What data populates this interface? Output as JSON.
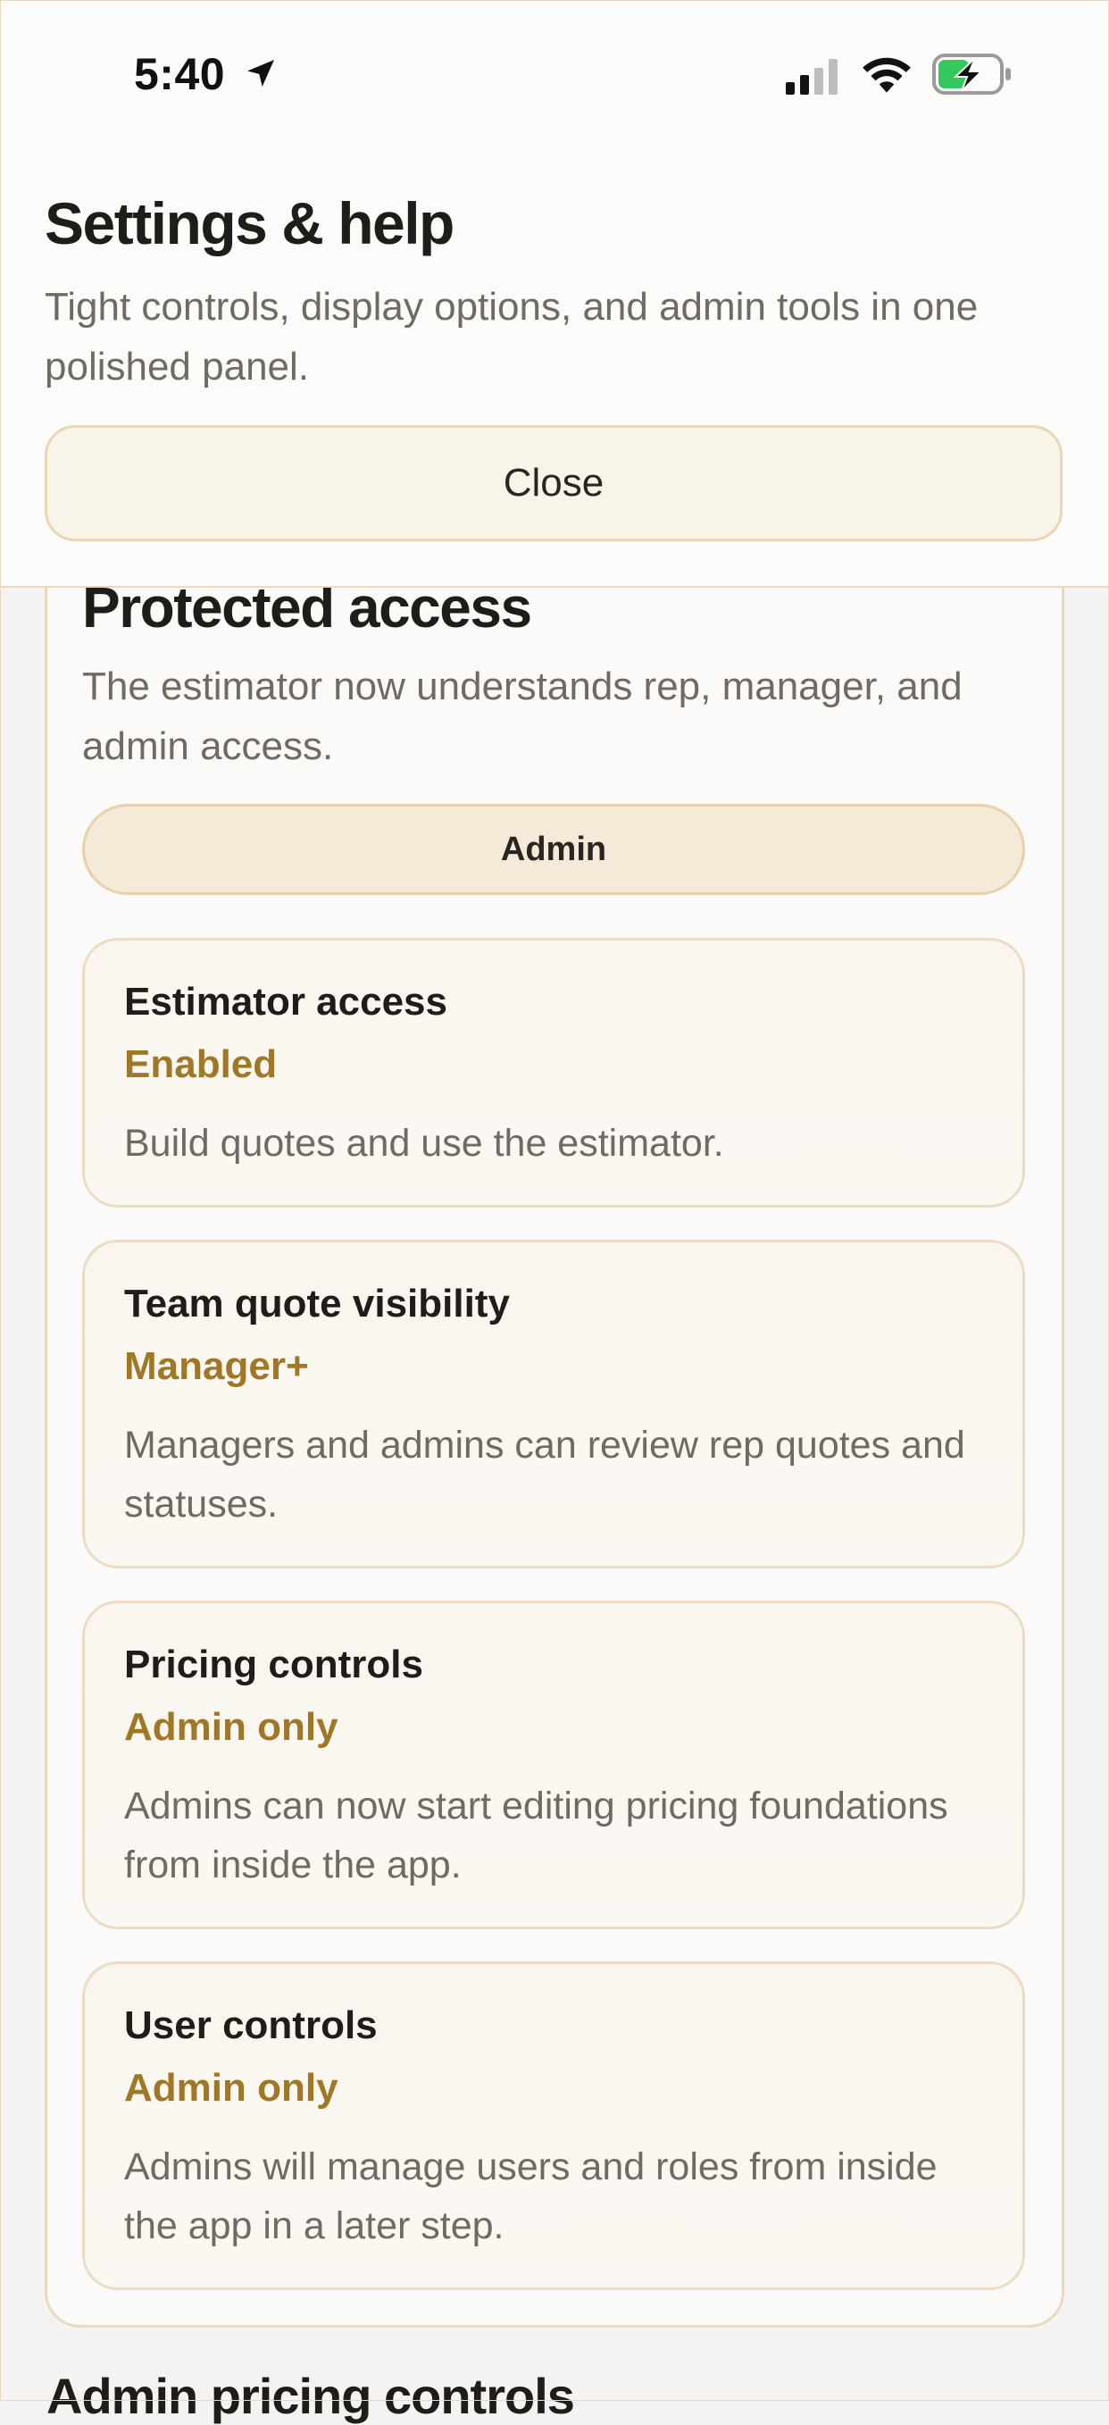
{
  "status_bar": {
    "time": "5:40"
  },
  "header": {
    "title": "Settings & help",
    "subtitle": "Tight controls, display options, and admin tools in one polished panel.",
    "close_label": "Close"
  },
  "access": {
    "title": "Protected access",
    "subtitle": "The estimator now understands rep, manager, and admin access.",
    "current_role": "Admin",
    "permissions": [
      {
        "name": "Estimator access",
        "status": "Enabled",
        "description": "Build quotes and use the estimator."
      },
      {
        "name": "Team quote visibility",
        "status": "Manager+",
        "description": "Managers and admins can review rep quotes and statuses."
      },
      {
        "name": "Pricing controls",
        "status": "Admin only",
        "description": "Admins can now start editing pricing foundations from inside the app."
      },
      {
        "name": "User controls",
        "status": "Admin only",
        "description": "Admins will manage users and roles from inside the app in a later step."
      }
    ]
  },
  "next_section_title": "Admin pricing controls",
  "colors": {
    "accent": "#9f7727",
    "border": "#ead8bf",
    "pill_bg": "#f5e9d8"
  },
  "icons": [
    "location-arrow-icon",
    "signal-icon",
    "wifi-icon",
    "battery-charging-icon"
  ]
}
